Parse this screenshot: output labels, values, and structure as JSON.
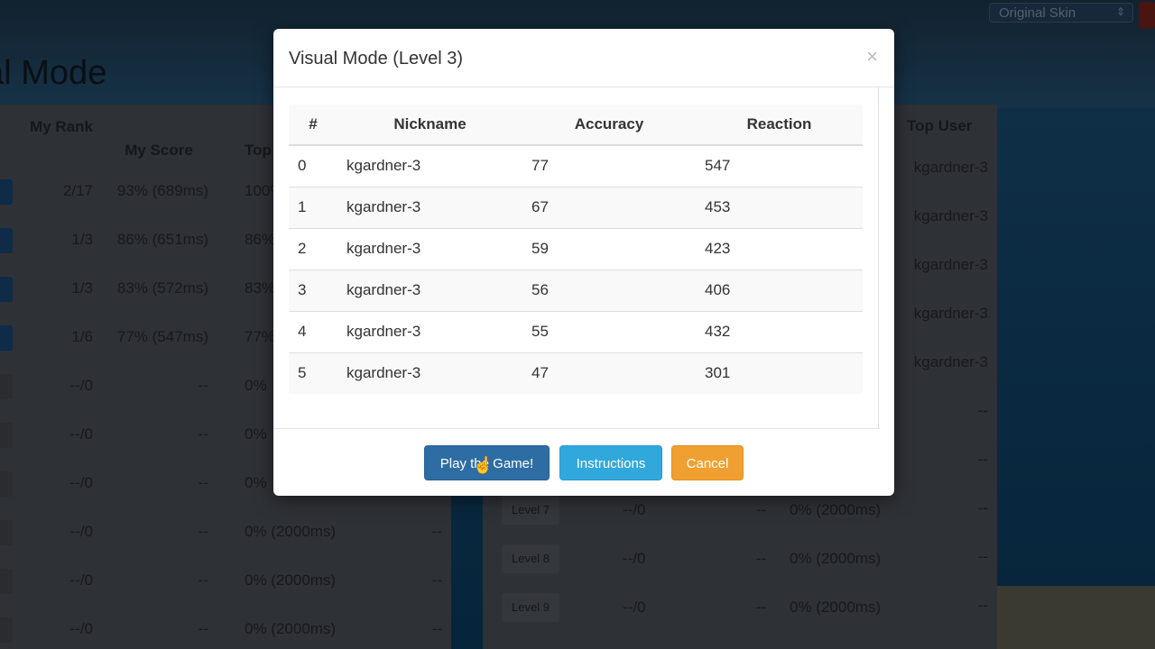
{
  "page": {
    "title": "ual Mode",
    "skin_select": "Original Skin"
  },
  "left_table": {
    "headers": {
      "rank": "My Rank",
      "score": "My Score",
      "top": "Top"
    },
    "rows": [
      {
        "rank": "2/17",
        "score": "93% (689ms)",
        "top": "100%",
        "user": ""
      },
      {
        "rank": "1/3",
        "score": "86% (651ms)",
        "top": "86%",
        "user": ""
      },
      {
        "rank": "1/3",
        "score": "83% (572ms)",
        "top": "83%",
        "user": ""
      },
      {
        "rank": "1/6",
        "score": "77% (547ms)",
        "top": "77%",
        "user": ""
      },
      {
        "rank": "--/0",
        "score": "--",
        "top": "0%",
        "user": ""
      },
      {
        "rank": "--/0",
        "score": "--",
        "top": "0%",
        "user": ""
      },
      {
        "rank": "--/0",
        "score": "--",
        "top": "0%",
        "user": ""
      },
      {
        "rank": "--/0",
        "score": "--",
        "top": "0% (2000ms)",
        "user": "--"
      },
      {
        "rank": "--/0",
        "score": "--",
        "top": "0% (2000ms)",
        "user": "--"
      },
      {
        "rank": "--/0",
        "score": "--",
        "top": "0% (2000ms)",
        "user": "--"
      }
    ]
  },
  "right_table": {
    "header_top_user": "Top User",
    "top_users": [
      "kgardner-3",
      "kgardner-3",
      "kgardner-3",
      "kgardner-3",
      "kgardner-3",
      "--",
      "--",
      "--",
      "--",
      "--"
    ],
    "levels": [
      {
        "label": "Level 7",
        "rank": "--/0",
        "score": "--",
        "top": "0% (2000ms)"
      },
      {
        "label": "Level 8",
        "rank": "--/0",
        "score": "--",
        "top": "0% (2000ms)"
      },
      {
        "label": "Level 9",
        "rank": "--/0",
        "score": "--",
        "top": "0% (2000ms)"
      }
    ]
  },
  "modal": {
    "title": "Visual Mode (Level 3)",
    "close": "×",
    "headers": [
      "#",
      "Nickname",
      "Accuracy",
      "Reaction"
    ],
    "rows": [
      [
        "0",
        "kgardner-3",
        "77",
        "547"
      ],
      [
        "1",
        "kgardner-3",
        "67",
        "453"
      ],
      [
        "2",
        "kgardner-3",
        "59",
        "423"
      ],
      [
        "3",
        "kgardner-3",
        "56",
        "406"
      ],
      [
        "4",
        "kgardner-3",
        "55",
        "432"
      ],
      [
        "5",
        "kgardner-3",
        "47",
        "301"
      ]
    ],
    "buttons": {
      "play": "Play the Game!",
      "instructions": "Instructions",
      "cancel": "Cancel"
    }
  }
}
